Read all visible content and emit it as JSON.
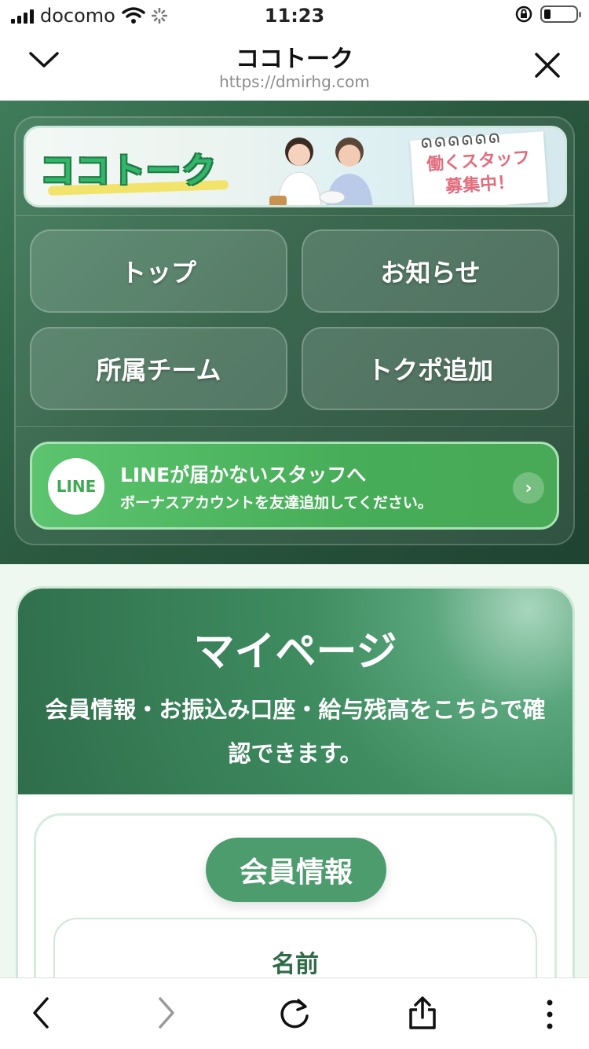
{
  "status_bar": {
    "carrier": "docomo",
    "time": "11:23"
  },
  "browser": {
    "title": "ココトーク",
    "url": "https://dmirhg.com"
  },
  "banner": {
    "logo_text": "ココトーク",
    "note_line1": "働くスタッフ",
    "note_line2": "募集中！"
  },
  "nav": {
    "buttons": [
      {
        "label": "トップ"
      },
      {
        "label": "お知らせ"
      },
      {
        "label": "所属チーム"
      },
      {
        "label": "トクポ追加"
      }
    ]
  },
  "line_banner": {
    "logo": "LINE",
    "title": "LINEが届かないスタッフへ",
    "subtitle": "ボーナスアカウントを友達追加してください。",
    "arrow": "›"
  },
  "mypage": {
    "title": "マイページ",
    "description": "会員情報・お振込み口座・給与残高をこちらで確認できます。",
    "section_pill": "会員情報",
    "field_label": "名前"
  },
  "icons": {
    "chevron": "chevron-down-icon",
    "close": "close-icon",
    "back": "back-icon",
    "forward": "forward-icon",
    "reload": "reload-icon",
    "share": "share-icon",
    "more": "more-icon"
  }
}
